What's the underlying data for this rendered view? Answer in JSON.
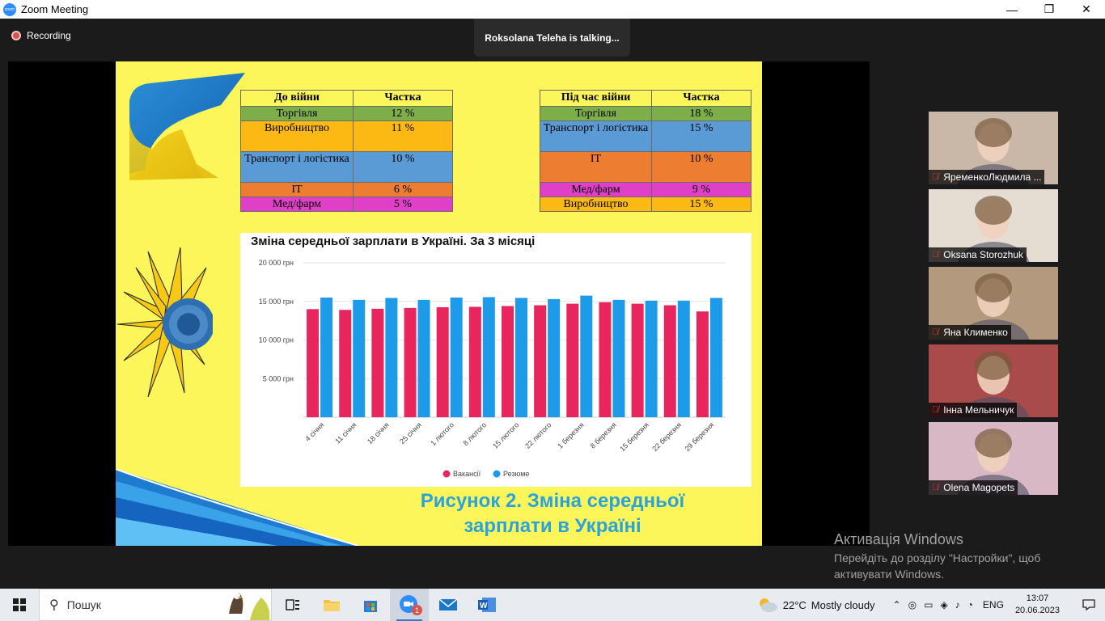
{
  "window": {
    "title": "Zoom Meeting",
    "minimize": "—",
    "maximize": "❐",
    "close": "✕"
  },
  "meeting": {
    "recording_label": "Recording",
    "talking": "Roksolana Teleha is talking..."
  },
  "slide": {
    "table_before": {
      "headers": [
        "До війни",
        "Частка"
      ],
      "rows": [
        {
          "label": "Торгівля",
          "value": "12 %",
          "color": "#7dae4a"
        },
        {
          "label": "Виробництво",
          "value": "11 %",
          "color": "#fdb913"
        },
        {
          "label": "Транспорт і логістика",
          "value": "10 %",
          "color": "#5b9bd5"
        },
        {
          "label": "ІТ",
          "value": "6 %",
          "color": "#ed7d31"
        },
        {
          "label": "Мед/фарм",
          "value": "5 %",
          "color": "#e040c8"
        }
      ]
    },
    "table_during": {
      "headers": [
        "Під час війни",
        "Частка"
      ],
      "rows": [
        {
          "label": "Торгівля",
          "value": "18 %",
          "color": "#7dae4a"
        },
        {
          "label": "Транспорт і логістика",
          "value": "15 %",
          "color": "#5b9bd5"
        },
        {
          "label": "ІТ",
          "value": "10 %",
          "color": "#ed7d31"
        },
        {
          "label": "Мед/фарм",
          "value": "9 %",
          "color": "#e040c8"
        },
        {
          "label": "Виробництво",
          "value": "15 %",
          "color": "#fdb913"
        }
      ]
    },
    "caption_line1": "Рисунок 2. Зміна середньої",
    "caption_line2": "зарплати в Україні"
  },
  "chart_data": {
    "type": "bar",
    "title": "Зміна середньої зарплати в Україні. За 3 місяці",
    "categories": [
      "4 січня",
      "11 січня",
      "18 січня",
      "25 січня",
      "1 лютого",
      "8 лютого",
      "15 лютого",
      "22 лютого",
      "1 березня",
      "8 березня",
      "15 березня",
      "22 березня",
      "29 березня"
    ],
    "series": [
      {
        "name": "Вакансії",
        "color": "#e8265e",
        "values": [
          14000,
          13900,
          14050,
          14150,
          14250,
          14300,
          14400,
          14500,
          14700,
          14900,
          14700,
          14500,
          13700
        ]
      },
      {
        "name": "Резюме",
        "color": "#1e9be8",
        "values": [
          15500,
          15200,
          15450,
          15200,
          15500,
          15550,
          15450,
          15300,
          15750,
          15200,
          15100,
          15100,
          15450
        ]
      }
    ],
    "yticks": [
      "20 000 грн",
      "15 000 грн",
      "10 000 грн",
      "5 000 грн"
    ],
    "ytick_values": [
      20000,
      15000,
      10000,
      5000
    ],
    "ylim": [
      0,
      20000
    ],
    "legend_position": "bottom"
  },
  "participants": [
    {
      "name": "ЯременкоЛюдмила ...",
      "bg": "#c9b8a8"
    },
    {
      "name": "Oksana Storozhuk",
      "bg": "#e6ddd2"
    },
    {
      "name": "Яна Клименко",
      "bg": "#b39a7e"
    },
    {
      "name": "Інна Мельничук",
      "bg": "#a94b4b"
    },
    {
      "name": "Olena Magopets",
      "bg": "#d8b8c4"
    }
  ],
  "activation": {
    "title": "Активація Windows",
    "line1": "Перейдіть до розділу \"Настройки\", щоб",
    "line2": "активувати Windows."
  },
  "taskbar": {
    "search_label": "Пошук",
    "zoom_badge": "1",
    "weather": {
      "temp": "22°C",
      "desc": "Mostly cloudy"
    },
    "lang": "ENG",
    "time": "13:07",
    "date": "20.06.2023"
  }
}
